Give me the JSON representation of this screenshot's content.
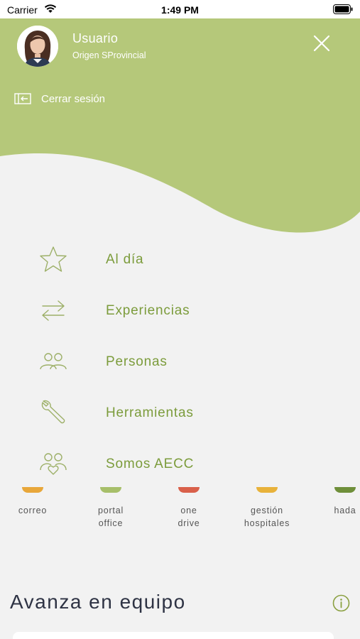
{
  "status_bar": {
    "carrier": "Carrier",
    "time": "1:49 PM"
  },
  "header": {
    "user_name": "Usuario",
    "user_origin": "Origen SProvincial",
    "logout_label": "Cerrar sesión",
    "color": "#b5c87a"
  },
  "menu": {
    "items": [
      {
        "label": "Al día",
        "icon": "star-icon"
      },
      {
        "label": "Experiencias",
        "icon": "arrows-exchange-icon"
      },
      {
        "label": "Personas",
        "icon": "people-icon"
      },
      {
        "label": "Herramientas",
        "icon": "wrench-icon"
      },
      {
        "label": "Somos AECC",
        "icon": "people-heart-icon"
      }
    ],
    "label_color": "#7c9c3c"
  },
  "apps": [
    {
      "name": "correo",
      "color": "#e8a73a"
    },
    {
      "name": "portal\noffice",
      "color": "#a7bf6a"
    },
    {
      "name": "one\ndrive",
      "color": "#d9604a"
    },
    {
      "name": "gestión\nhospitales",
      "color": "#e8b23a"
    },
    {
      "name": "hada",
      "color": "#6f8f3a"
    }
  ],
  "section": {
    "title": "Avanza en equipo"
  }
}
